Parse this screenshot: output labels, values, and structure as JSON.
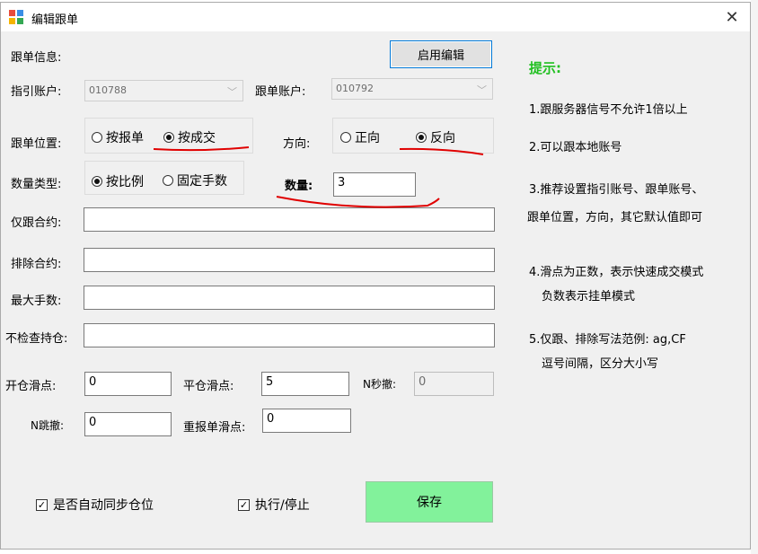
{
  "window": {
    "title": "编辑跟单"
  },
  "form": {
    "section_label": "跟单信息:",
    "enable_edit_button": "启用编辑",
    "guide_account_label": "指引账户:",
    "guide_account_value": "010788",
    "follow_account_label": "跟单账户:",
    "follow_account_value": "010792",
    "position_label": "跟单位置:",
    "position_options": [
      "按报单",
      "按成交"
    ],
    "position_selected": "按成交",
    "direction_label": "方向:",
    "direction_options": [
      "正向",
      "反向"
    ],
    "direction_selected": "反向",
    "quantity_type_label": "数量类型:",
    "quantity_type_options": [
      "按比例",
      "固定手数"
    ],
    "quantity_type_selected": "按比例",
    "quantity_label": "数量:",
    "quantity_value": "3",
    "only_contracts_label": "仅跟合约:",
    "only_contracts_value": "",
    "exclude_contracts_label": "排除合约:",
    "exclude_contracts_value": "",
    "max_lots_label": "最大手数:",
    "max_lots_value": "",
    "no_check_label": "不检查持仓:",
    "no_check_value": "",
    "open_slip_label": "开仓滑点:",
    "open_slip_value": "0",
    "close_slip_label": "平仓滑点:",
    "close_slip_value": "5",
    "n_sec_cancel_label": "N秒撤:",
    "n_sec_cancel_value": "0",
    "n_tick_cancel_label": "N跳撤:",
    "n_tick_cancel_value": "0",
    "resubmit_slip_label": "重报单滑点:",
    "resubmit_slip_value": "0",
    "auto_sync_label": "是否自动同步仓位",
    "run_stop_label": "执行/停止",
    "save_button": "保存"
  },
  "tips": {
    "heading": "提示:",
    "line1": "1.跟服务器信号不允许1倍以上",
    "line2": "2.可以跟本地账号",
    "line3a": "3.推荐设置指引账号、跟单账号、",
    "line3b": "跟单位置，方向，其它默认值即可",
    "line4a": "4.滑点为正数，表示快速成交模式",
    "line4b": "负数表示挂单模式",
    "line5a": "5.仅跟、排除写法范例:  ag,CF",
    "line5b": "逗号间隔，区分大小写"
  },
  "colors": {
    "save_button_bg": "#82f29b",
    "tips_heading": "#21c021",
    "annotation_red": "#e00000"
  }
}
